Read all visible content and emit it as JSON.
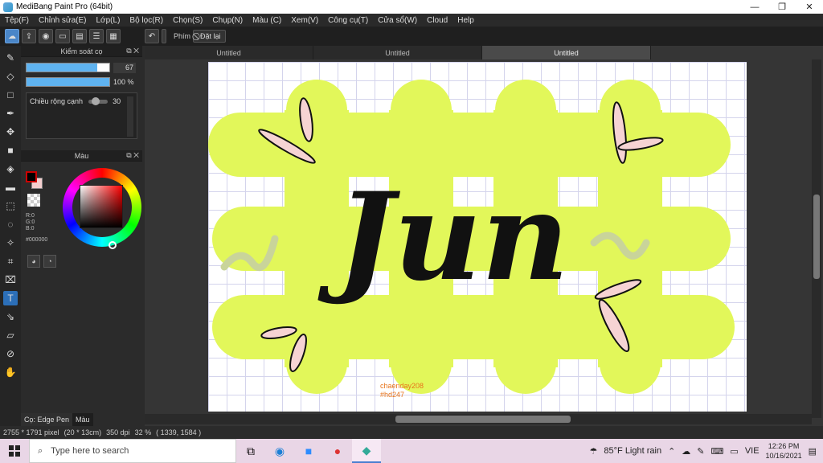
{
  "window": {
    "title": "MediBang Paint Pro (64bit)",
    "minimize": "—",
    "maximize": "❐",
    "close": "✕"
  },
  "menu": [
    "Tệp(F)",
    "Chỉnh sửa(E)",
    "Lớp(L)",
    "Bộ lọc(R)",
    "Chọn(S)",
    "Chụp(N)",
    "Màu (C)",
    "Xem(V)",
    "Công cụ(T)",
    "Cửa sổ(W)",
    "Cloud",
    "Help"
  ],
  "toolbar": {
    "key_label": "Phím",
    "reset_label": "Đặt lại"
  },
  "brush_panel": {
    "title": "Kiểm soát cọ",
    "size_value": "67",
    "size_level": 0.85,
    "opacity_value": "100 %",
    "opacity_level": 1.0,
    "edge_label": "Chiều rộng cạnh",
    "edge_value": "30"
  },
  "color_panel": {
    "title": "Màu",
    "rgb": "R:0\nG:0\nB:0",
    "hex": "#000000",
    "fg_color": "#000000",
    "bg_color": "#f5d0d0"
  },
  "bottom_tabs": [
    "Cọ: Edge Pen",
    "Màu"
  ],
  "doc_tabs": [
    "Untitled",
    "Untitled",
    "Untitled"
  ],
  "canvas": {
    "art_text": "Jun",
    "watermark_line1": "chaenday208",
    "watermark_line2": "#hd247",
    "shape_color": "#e2f75a"
  },
  "status": {
    "size": "2755 * 1791 pixel",
    "cm": "(20 * 13cm)",
    "dpi": "350 dpi",
    "zoom": "32 %",
    "coords": "( 1339, 1584 )"
  },
  "taskbar": {
    "search_placeholder": "Type here to search",
    "weather": "85°F  Light rain",
    "lang": "VIE",
    "time": "12:26 PM",
    "date": "10/16/2021"
  }
}
